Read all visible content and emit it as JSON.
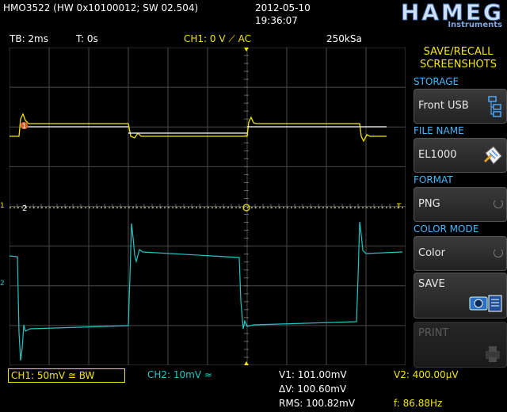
{
  "header": {
    "model": "HMO3522 (HW 0x10100012; SW 02.504)",
    "date": "2012-05-10",
    "time": "19:36:07",
    "brand": "HAMEG",
    "brand_sub": "Instruments"
  },
  "status": {
    "timebase": "TB: 2ms",
    "time_offset": "T: 0s",
    "trigger": "CH1: 0 V ⟋ AC",
    "sample_rate": "250kSa"
  },
  "markers": {
    "ch1_marker": "1",
    "ch2_marker": "2",
    "cursor_left": "1",
    "cursor_right": "T"
  },
  "menu": {
    "title_line1": "SAVE/RECALL",
    "title_line2": "SCREENSHOTS",
    "storage_label": "STORAGE",
    "storage_value": "Front USB",
    "filename_label": "FILE NAME",
    "filename_value": "EL1000",
    "format_label": "FORMAT",
    "format_value": "PNG",
    "colormode_label": "COLOR MODE",
    "colormode_value": "Color",
    "save_label": "SAVE",
    "print_label": "PRINT"
  },
  "measure": {
    "ch1": "CH1: 50mV ≅ BW",
    "ch2": "CH2: 10mV ≈",
    "v1": "V1: 101.00mV",
    "v2": "V2: 400.00µV",
    "delta_v": "ΔV: 100.60mV",
    "rms": "RMS: 100.82mV",
    "freq": "f: 86.88Hz"
  },
  "colors": {
    "ch1": "#f2e600",
    "ch2": "#1ec8c8",
    "grid": "#4a4a4a",
    "menu_label": "#44b8ff"
  }
}
